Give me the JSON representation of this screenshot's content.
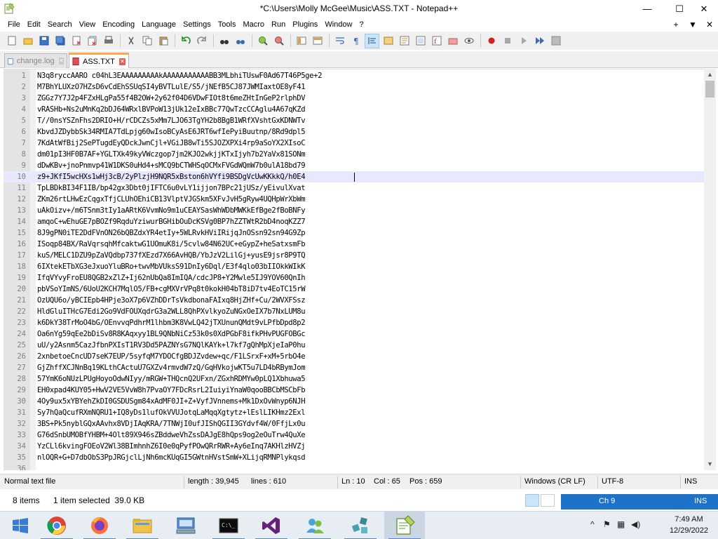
{
  "window": {
    "title": "*C:\\Users\\Molly McGee\\Music\\ASS.TXT - Notepad++",
    "min_glyph": "—",
    "max_glyph": "☐",
    "close_glyph": "✕"
  },
  "menu": {
    "items": [
      "File",
      "Edit",
      "Search",
      "View",
      "Encoding",
      "Language",
      "Settings",
      "Tools",
      "Macro",
      "Run",
      "Plugins",
      "Window",
      "?"
    ],
    "right": [
      "+",
      "▼",
      "✕"
    ]
  },
  "tabs": [
    {
      "label": "change.log",
      "active": false
    },
    {
      "label": "ASS.TXT",
      "active": true
    }
  ],
  "editor": {
    "current_line": 10,
    "lines": [
      "N3q8ryccAARO c04hL3EAAAAAAAAAkAAAAAAAAAAABB3MLbhiTUswF0Ad67T46P5ge+2",
      "M7BhYLUXzO7HZsD6vCdEhSSUqSI4yBVTLulE/S5/jNEfB5CJ87JWMIaxtOE8yF41",
      "ZGGz7Y7J2p4FZxHLgPa55f4B2OW+2y62f04D6VDwFIOt8t6meZHtInGeP2rlphDV",
      "vRASHb+Ns2uMnKq2bDJ64WRxlBVPoW13jUk12eIxBBc77QwTzcCCAglu4A67qKZd",
      "T//0nsYSZnFhs2DRIO+H/rCDCZs5xMm7LJO63TgYH2b8BgB1WRfXVshtGxKDNWTv",
      "KbvdJZDybbSk34RMIA7TdLpjg60wIsoBCyAsE6JRT6wfIePyiBuutnp/8Rd9dpl5",
      "7KdAtWfBij2SePTugdEyQDckJwnCjl+VGiJB8wTi5SJOZXPXi4rp9aSoYX2XIsoC",
      "dm01pI3HF0B7AF+YGLTXk49kyVWczgop7jm2KJO2wkjjKTxIjyh7b2YaVx81SONm",
      "dDwKBv+jnoPnmvp41W1DKS0uHd4+sMCQ9bCTWHSqOCMxFVGdWQmW7b0ulA18bd79",
      "z9+JKfI5wcHXs1wHj3cB/2yPlzjH9NQR5xBston6hVYfi9BSDgVcUwKKkkQ/h0E4",
      "TpLBDkBI34F1IB/bp42gx3Dbt0jIFTC6u0vLY1ijjon7BPc21jUSz/yEivulXvat",
      "ZKm26rtLHwEzCqgxTfjCLUhOEhiCB13VlptVJGSkm5XFvJvH5gRyw4UQHpWrXbWm",
      "uAkOizv+/m6TSnm3tIy1aARtK6VvmNo9m1uCEAYSasWhWDbMWKkEfBge2fBoBNFy",
      "amqoC+wEhuGE7pBOZf9RqduYziwurBGHibOuDcKSVg0BP7hZZTWtR2bD4noqKZZ7",
      "8J9gPN0iTE2DdFVnON26bQBZdxYR4etIy+5WLRvkHViIRijqJnOSsn92sn94G9Zp",
      "ISoqp84BX/RaVqrsqhMfcaktwG1UOmuK8i/5cvlw84N62UC+eGypZ+heSatxsmFb",
      "kuS/MELC1DZU9pZaVQdbp737fXEzd7X66AvHQB/YbJzV2LilGj+yusE9jsr8P9TQ",
      "6IXtekETbXG3eJxuoYluBRo+twvMbVUksS91DnIy6Dql/E3f4qlo03bIIOkkWIkK",
      "IfqVYvyFroEU8QGB2xZlZ+Ij62nUbQa8ImIQA/cdcJP8+Y2Mwle5IJ9YOV60QnIh",
      "pbVSoYImNS/6UoU2KCH7MqlO5/FB+cgMXVrVPq8t0kokH04bT8iD7tv4EoTC15rW",
      "OzUQU6o/yBCIEpb4HPje3oX7p6VZhDDrTsVkdbonaFAIxq8HjZHf+Cu/2WVXFSsz",
      "HldGluITHcG7Edi2Go9VdFOUXqdrG3a2WLL8QhPXvlkyoZuNGxOeIX7b7NxLUM8u",
      "k6DkY38TrMoO4bG/OEnvvqPdhrM1lhbm3K8VwLQ42jTXUnunQMdt9vLPfbDpd8p2",
      "Oa6nYg59qEe2bDiSv8R8KAqxyy1BL9QNbNiCz53k0s0XdPGbF8ifkPHvPUGFOBGc",
      "uU/y2Asnm5CazJfbnPXIsT1RV3Dd5PAZNYsG7NQlKAYk+l7kf7gQhMpXjeIaP0hu",
      "2xnbetoeCncUD7seK7EUP/5syfqM7YDOCfgBDJZvdew+qc/F1LSrxF+xM+5rbO4e",
      "GjZhffXCJNnBq19KLthCActuU7GXZv4rmvdW7zQ/GqHVkojwKT5u7LD4bRBymJom",
      "57YmK6oNUzLPUgHoyoOdwNIyy/mRGW+THQcnQ2UFxn/ZGxhRDMYw0pLQ1Xbhuwa5",
      "EH0xpad4KUY05+HwV2VE5VvW8h7PvaOY7FDcRsrL2IuiyiYnaW0qooBBCbMSCbFb",
      "4Oy9ux5xYBYehZkDI0GSDUSgm84xAdMF0JI+Z+VyfJVnnems+Mk1DxOvWnyp6NJH",
      "Sy7hQaQcufRXmNQRU1+IQ8yDs1lufOkVVUJotqLaMqqXgtytz+lEslLIKHmz2Exl",
      "3BS+Pk5nyblGQxAAvhx8VDjIAqKRA/7TNWjI0ufJIShQGII3GYdvf4W/0FfjLx0u",
      "G76dSnbUMOBfYHBM+4Olt89X946sZBddweVhZssDAJgE8hQps9og2eOuTrw4QuXe",
      "YzCLl6kvingFOEoV2Wl38BImhnhZ6I0e0qPyfPOwQRrRWR+Ay6eInq7AKHlzHVZj",
      "nlOQR+G+D7dbObS3PpJRGjclLjNh6mcKUqGI5GWtnHVstSmW+XLijqRMNPlykqsd",
      "_"
    ]
  },
  "statusbar": {
    "file_type": "Normal text file",
    "length": "length : 39,945",
    "lines": "lines : 610",
    "ln": "Ln : 10",
    "col": "Col : 65",
    "pos": "Pos : 659",
    "eol": "Windows (CR LF)",
    "encoding": "UTF-8",
    "mode": "INS"
  },
  "explorer": {
    "items_count": "8 items",
    "selection": "1 item selected  39.0 KB",
    "ch": "Ch 9",
    "ins": "INS"
  },
  "taskbar": {
    "apps": [
      "start",
      "chrome",
      "firefox",
      "file-explorer",
      "remote-desktop",
      "terminal",
      "visual-studio",
      "people",
      "network-app",
      "notepad-plus-plus"
    ],
    "time": "7:49 AM",
    "date": "12/29/2022"
  },
  "colors": {
    "current_line_bg": "#e8e8ff",
    "tab_active_accent": "#f9a84a",
    "gutter_bg": "#e4e4e4",
    "ch_bar_bg": "#1e73c8"
  }
}
